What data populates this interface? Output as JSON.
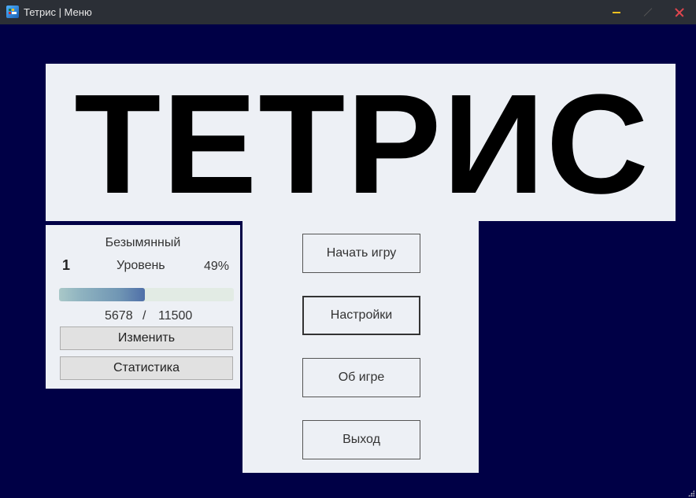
{
  "window": {
    "title": "Тетрис | Меню",
    "icon": "tetris-app-icon",
    "controls": {
      "minimize": "minimize-icon",
      "maximize": "maximize-icon",
      "close": "close-icon"
    }
  },
  "banner": {
    "title": "ТЕТРИС"
  },
  "menu": {
    "start_label": "Начать игру",
    "settings_label": "Настройки",
    "about_label": "Об игре",
    "exit_label": "Выход"
  },
  "profile": {
    "name": "Безымянный",
    "level_number": "1",
    "level_label": "Уровень",
    "level_percent": "49%",
    "progress_fraction": 0.49,
    "xp_current": "5678",
    "xp_separator": "/",
    "xp_total": "11500",
    "change_label": "Изменить",
    "stats_label": "Статистика"
  },
  "colors": {
    "background": "#000046",
    "panel": "#edf0f5",
    "titlebar": "#2b2f36",
    "close_accent": "#e0464e",
    "minimize_accent": "#f0c020"
  }
}
